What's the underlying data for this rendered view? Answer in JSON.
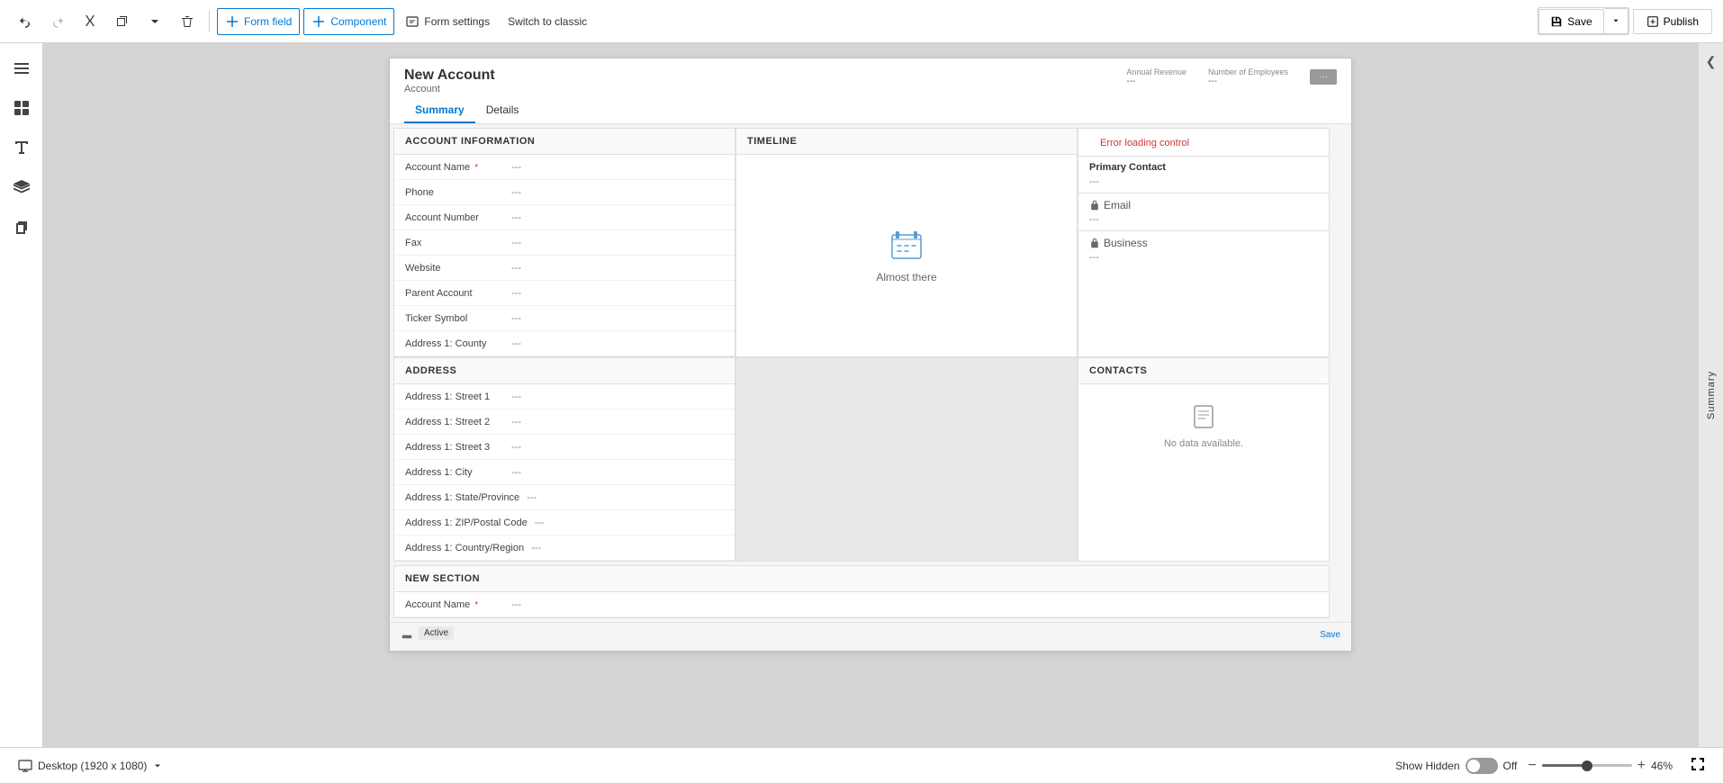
{
  "toolbar": {
    "undo_label": "Undo",
    "redo_label": "Redo",
    "cut_label": "Cut",
    "copy_label": "Copy",
    "delete_label": "Delete",
    "form_field_label": "Form field",
    "component_label": "Component",
    "form_settings_label": "Form settings",
    "switch_classic_label": "Switch to classic",
    "save_label": "Save",
    "publish_label": "Publish"
  },
  "sidebar": {
    "icons": [
      "menu",
      "grid",
      "text",
      "layers",
      "copy"
    ]
  },
  "form": {
    "title": "New Account",
    "subtitle": "Account",
    "header_fields": [
      {
        "label": "Annual Revenue",
        "value": "---"
      },
      {
        "label": "Number of Employees",
        "value": "---"
      }
    ],
    "tabs": [
      {
        "label": "Summary",
        "active": true
      },
      {
        "label": "Details",
        "active": false
      }
    ],
    "account_section": {
      "header": "ACCOUNT INFORMATION",
      "fields": [
        {
          "label": "Account Name",
          "required": true,
          "value": "---"
        },
        {
          "label": "Phone",
          "value": "---"
        },
        {
          "label": "Account Number",
          "value": "---"
        },
        {
          "label": "Fax",
          "value": "---"
        },
        {
          "label": "Website",
          "value": "---"
        },
        {
          "label": "Parent Account",
          "value": "---"
        },
        {
          "label": "Ticker Symbol",
          "value": "---"
        },
        {
          "label": "Address 1: County",
          "value": "---"
        }
      ]
    },
    "address_section": {
      "header": "ADDRESS",
      "fields": [
        {
          "label": "Address 1: Street 1",
          "value": "---"
        },
        {
          "label": "Address 1: Street 2",
          "value": "---"
        },
        {
          "label": "Address 1: Street 3",
          "value": "---"
        },
        {
          "label": "Address 1: City",
          "value": "---"
        },
        {
          "label": "Address 1: State/Province",
          "value": "---"
        },
        {
          "label": "Address 1: ZIP/Postal Code",
          "value": "---"
        },
        {
          "label": "Address 1: Country/Region",
          "value": "---"
        }
      ]
    },
    "timeline_section": {
      "header": "Timeline",
      "almost_there_text": "Almost there"
    },
    "right_section": {
      "error_text": "Error loading control",
      "primary_contact_label": "Primary Contact",
      "primary_contact_value": "---",
      "email_label": "Email",
      "email_value": "---",
      "business_label": "Business",
      "business_value": "---"
    },
    "contacts_section": {
      "header": "CONTACTS",
      "no_data_text": "No data available."
    },
    "new_section": {
      "header": "New Section",
      "fields": [
        {
          "label": "Account Name",
          "required": true,
          "value": "---"
        }
      ]
    }
  },
  "bottom_bar": {
    "active_label": "Active",
    "save_label": "Save"
  },
  "footer": {
    "desktop_label": "Desktop (1920 x 1080)",
    "show_hidden_label": "Show Hidden",
    "toggle_state": "Off",
    "zoom_minus": "−",
    "zoom_plus": "+",
    "zoom_level": "46%"
  },
  "right_sidebar": {
    "label": "Summary"
  }
}
